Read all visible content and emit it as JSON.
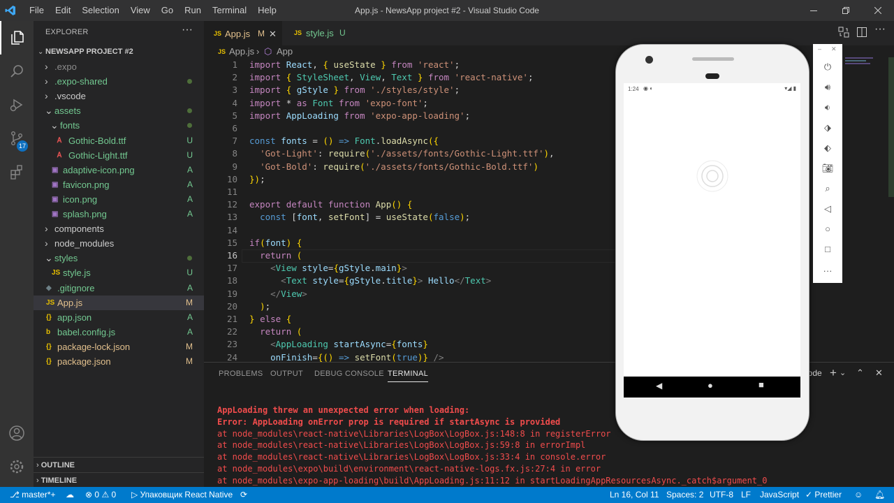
{
  "window": {
    "title": "App.js - NewsApp project #2 - Visual Studio Code",
    "menu": [
      "File",
      "Edit",
      "Selection",
      "View",
      "Go",
      "Run",
      "Terminal",
      "Help"
    ]
  },
  "activity": {
    "scm_badge": "17"
  },
  "explorer": {
    "header": "EXPLORER",
    "more": "···",
    "project": "NEWSAPP PROJECT #2",
    "items": [
      {
        "label": ".expo",
        "icon": "chevron",
        "status": ""
      },
      {
        "label": ".expo-shared",
        "icon": "chevron",
        "status": "dot"
      },
      {
        "label": ".vscode",
        "icon": "chevron",
        "status": ""
      },
      {
        "label": "assets",
        "icon": "chevron-open",
        "status": "dot"
      },
      {
        "label": "fonts",
        "icon": "chevron-open",
        "status": "dot"
      },
      {
        "label": "Gothic-Bold.ttf",
        "icon": "font",
        "status": "U"
      },
      {
        "label": "Gothic-Light.ttf",
        "icon": "font",
        "status": "U"
      },
      {
        "label": "adaptive-icon.png",
        "icon": "image",
        "status": "A"
      },
      {
        "label": "favicon.png",
        "icon": "image",
        "status": "A"
      },
      {
        "label": "icon.png",
        "icon": "image",
        "status": "A"
      },
      {
        "label": "splash.png",
        "icon": "image",
        "status": "A"
      },
      {
        "label": "components",
        "icon": "chevron",
        "status": ""
      },
      {
        "label": "node_modules",
        "icon": "chevron",
        "status": ""
      },
      {
        "label": "styles",
        "icon": "chevron-open",
        "status": "dot"
      },
      {
        "label": "style.js",
        "icon": "js",
        "status": "U"
      },
      {
        "label": ".gitignore",
        "icon": "git",
        "status": "A"
      },
      {
        "label": "App.js",
        "icon": "js",
        "status": "M"
      },
      {
        "label": "app.json",
        "icon": "json",
        "status": "A"
      },
      {
        "label": "babel.config.js",
        "icon": "babel",
        "status": "A"
      },
      {
        "label": "package-lock.json",
        "icon": "json",
        "status": "M"
      },
      {
        "label": "package.json",
        "icon": "json",
        "status": "M"
      }
    ],
    "outline": "OUTLINE",
    "timeline": "TIMELINE"
  },
  "tabs": [
    {
      "label": "App.js",
      "flag": "M",
      "badge": "JS"
    },
    {
      "label": "style.js",
      "flag": "U",
      "badge": "JS"
    }
  ],
  "breadcrumb": {
    "file": "App.js",
    "symbol": "App"
  },
  "code": {
    "current_line": 16,
    "lines": [
      "import React, { useState } from 'react';",
      "import { StyleSheet, View, Text } from 'react-native';",
      "import { gStyle } from './styles/style';",
      "import * as Font from 'expo-font';",
      "import AppLoading from 'expo-app-loading';",
      "",
      "const fonts = () => Font.loadAsync({",
      "  'Got-Light': require('./assets/fonts/Gothic-Light.ttf'),",
      "  'Got-Bold': require('./assets/fonts/Gothic-Bold.ttf')",
      "});",
      "",
      "export default function App() {",
      "  const [font, setFont] = useState(false);",
      "",
      "if(font) {",
      "  return (",
      "    <View style={gStyle.main}>",
      "      <Text style={gStyle.title}> Hello</Text>",
      "    </View>",
      "  );",
      "} else {",
      "  return (",
      "    <AppLoading startAsync={fonts}",
      "    onFinish={() => setFont(true)} />"
    ]
  },
  "panel": {
    "tabs": [
      "PROBLEMS",
      "OUTPUT",
      "DEBUG CONSOLE",
      "TERMINAL"
    ],
    "selected": "TERMINAL",
    "node_label": "node",
    "terminal": [
      "AppLoading threw an unexpected error when loading:",
      "Error: AppLoading onError prop is required if startAsync is provided",
      "at node_modules\\react-native\\Libraries\\LogBox\\LogBox.js:148:8 in registerError",
      "at node_modules\\react-native\\Libraries\\LogBox\\LogBox.js:59:8 in errorImpl",
      "at node_modules\\react-native\\Libraries\\LogBox\\LogBox.js:33:4 in console.error",
      "at node_modules\\expo\\build\\environment\\react-native-logs.fx.js:27:4 in error",
      "at node_modules\\expo-app-loading\\build\\AppLoading.js:11:12 in startLoadingAppResourcesAsync._catch$argument_0"
    ]
  },
  "status": {
    "branch": "master*+",
    "errors": "0",
    "warnings": "0",
    "task": "Упаковщик React Native",
    "position": "Ln 16, Col 11",
    "spaces": "Spaces: 2",
    "encoding": "UTF-8",
    "eol": "LF",
    "language": "JavaScript",
    "prettier": "Prettier"
  },
  "emulator": {
    "time": "1:24"
  }
}
